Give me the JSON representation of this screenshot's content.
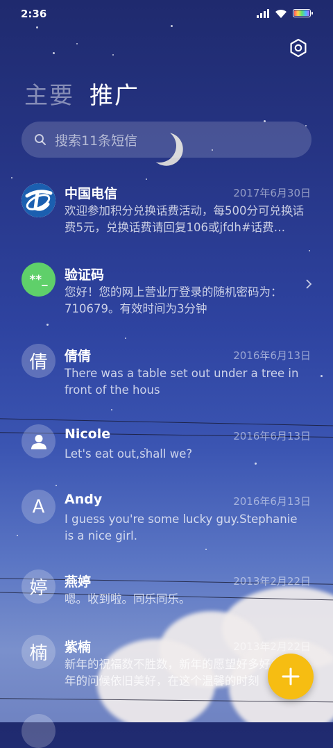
{
  "status_bar": {
    "time": "2:36"
  },
  "header": {
    "tabs": [
      {
        "label": "主要",
        "active": false
      },
      {
        "label": "推广",
        "active": true
      }
    ],
    "settings_icon": "settings-hexagon-icon"
  },
  "search": {
    "placeholder": "搜索11条短信",
    "icon": "search-icon"
  },
  "conversations": [
    {
      "name": "中国电信",
      "date": "2017年6月30日",
      "preview": "欢迎参加积分兑换话费活动，每500分可兑换话费5元，兑换话费请回复106或jfdh#话费…",
      "avatar": "china-telecom-logo"
    },
    {
      "name": "验证码",
      "date": "",
      "preview": "您好！您的网上营业厅登录的随机密码为：710679。有效时间为3分钟",
      "avatar_text": "**_",
      "avatar_color": "#5fd06a",
      "has_chevron": true
    },
    {
      "name": "倩倩",
      "date": "2016年6月13日",
      "preview": "There was a table set out under a tree in front of the hous",
      "avatar_text": "倩"
    },
    {
      "name": "Nicole",
      "date": "2016年6月13日",
      "preview": "Let's eat out,shall we?",
      "avatar": "person-icon"
    },
    {
      "name": "Andy",
      "date": "2016年6月13日",
      "preview": "I guess you're some lucky guy.Stephanie is a nice girl.",
      "avatar_text": "A"
    },
    {
      "name": "燕婷",
      "date": "2013年2月22日",
      "preview": "嗯。收到啦。同乐同乐。",
      "avatar_text": "婷"
    },
    {
      "name": "紫楠",
      "date": "2013年2月22日",
      "preview": "新年的祝福数不胜数，新年的愿望好多好多，新年的问候依旧美好，在这个温馨的时刻",
      "avatar_text": "楠"
    }
  ],
  "fab": {
    "icon": "plus-icon",
    "color": "#f6bd12"
  }
}
